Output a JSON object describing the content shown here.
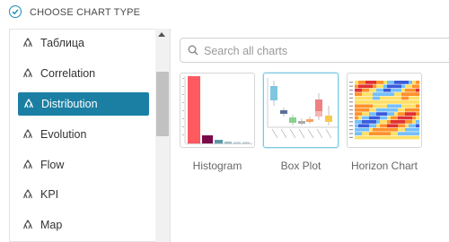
{
  "header": {
    "title": "CHOOSE CHART TYPE",
    "icon": "check-circle-icon"
  },
  "sidebar": {
    "items": [
      {
        "label": "Таблица",
        "active": false
      },
      {
        "label": "Correlation",
        "active": false
      },
      {
        "label": "Distribution",
        "active": true
      },
      {
        "label": "Evolution",
        "active": false
      },
      {
        "label": "Flow",
        "active": false
      },
      {
        "label": "KPI",
        "active": false
      },
      {
        "label": "Map",
        "active": false
      }
    ]
  },
  "search": {
    "placeholder": "Search all charts",
    "value": ""
  },
  "charts": [
    {
      "label": "Histogram",
      "selected": false
    },
    {
      "label": "Box Plot",
      "selected": true
    },
    {
      "label": "Horizon Chart",
      "selected": false
    }
  ],
  "colors": {
    "accent": "#1b7fa3",
    "active_text": "#ffffff",
    "histogram_bar": "#ff5a5f",
    "histogram_bar_2": "#7a0a4a"
  }
}
